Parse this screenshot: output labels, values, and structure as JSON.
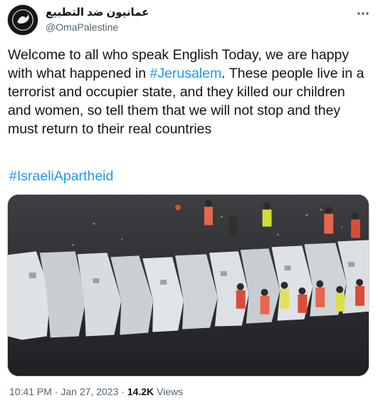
{
  "tweet": {
    "author_name": "عمانيون ضد التطبيع",
    "author_handle": "@OmaPalestine",
    "more_icon": "more-dots-icon",
    "text_part1": "Welcome to all who speak English Today, we are happy with what happened in ",
    "hashtag_jerusalem": "#Jerusalem",
    "text_part2": ". These people live in a terrorist and occupier state, and they killed our children and women, so tell them that we will not stop and they must return to their real countries",
    "hashtag_apartheid": "#IsraeliApartheid",
    "time": "10:41 PM",
    "separator": " · ",
    "date": "Jan 27, 2023",
    "views_count": "14.2K",
    "views_label": "Views"
  },
  "colors": {
    "text": "#0f1419",
    "secondary": "#536471",
    "link": "#1d9bf0",
    "border": "#cfd9de"
  }
}
